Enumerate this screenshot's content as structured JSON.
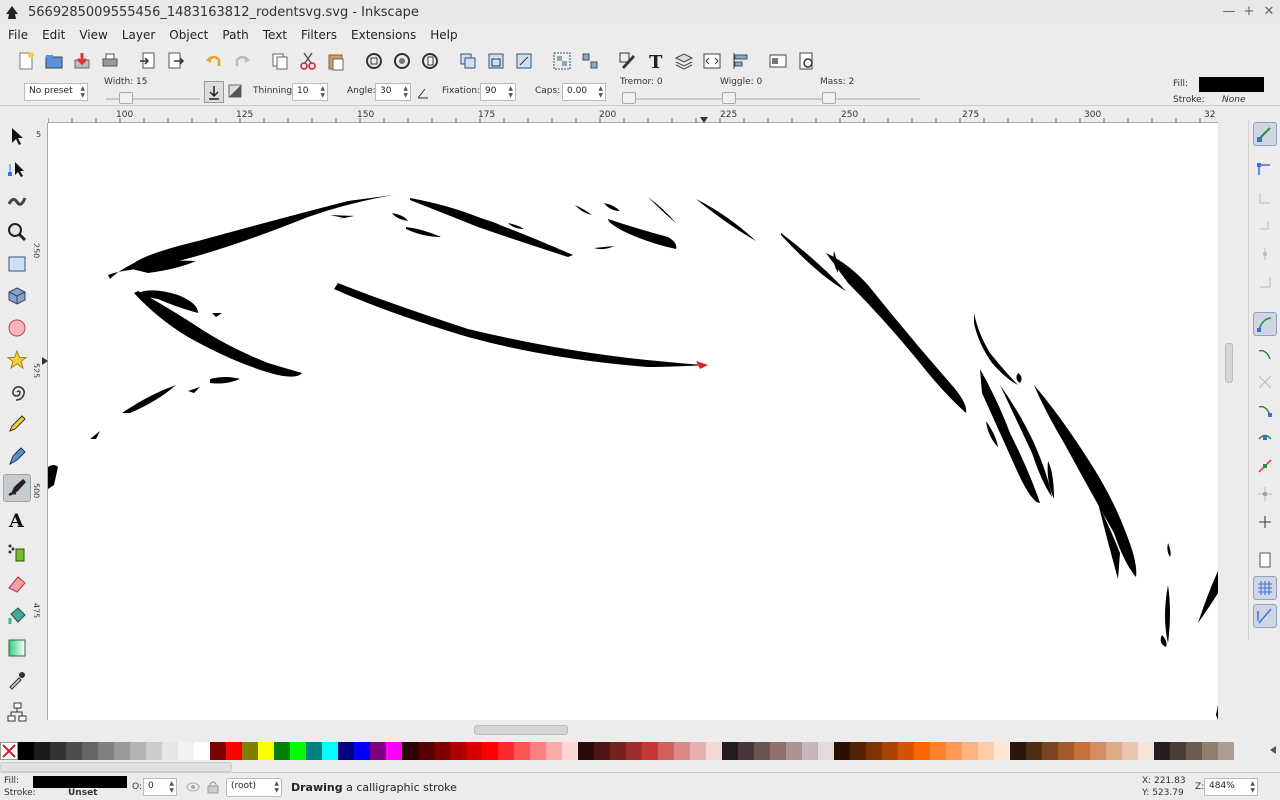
{
  "window": {
    "title": "5669285009555456_1483163812_rodentsvg.svg - Inkscape",
    "controls": [
      "—",
      "+",
      "✕"
    ]
  },
  "menu": [
    "File",
    "Edit",
    "View",
    "Layer",
    "Object",
    "Path",
    "Text",
    "Filters",
    "Extensions",
    "Help"
  ],
  "toolbar_icons": [
    "new-icon",
    "open-icon",
    "save-icon",
    "print-icon",
    "import-icon",
    "export-icon",
    "undo-icon",
    "redo-icon",
    "copy-icon",
    "cut-icon",
    "paste-icon",
    "zoom-selection-icon",
    "zoom-drawing-icon",
    "zoom-page-icon",
    "duplicate-icon",
    "clone-icon",
    "unlink-clone-icon",
    "group-icon",
    "ungroup-icon",
    "fill-stroke-icon",
    "text-font-icon",
    "layers-icon",
    "xml-editor-icon",
    "align-icon",
    "document-properties-icon",
    "preferences-icon"
  ],
  "calligraphy": {
    "preset": "No preset",
    "width_label": "Width: 15",
    "width_value": 15,
    "thinning_label": "Thinning:",
    "thinning_value": "10",
    "angle_label": "Angle:",
    "angle_value": "30",
    "fixation_label": "Fixation:",
    "fixation_value": "90",
    "caps_label": "Caps:",
    "caps_value": "0.00",
    "tremor_label": "Tremor: 0",
    "wiggle_label": "Wiggle: 0",
    "mass_label": "Mass: 2"
  },
  "style_indicator": {
    "fill_label": "Fill:",
    "stroke_label": "Stroke:",
    "stroke_value": "None",
    "fill_color": "#000000"
  },
  "ruler_h_ticks": [
    "100",
    "125",
    "150",
    "175",
    "200",
    "225",
    "250",
    "275",
    "300",
    "32"
  ],
  "ruler_v_ticks": [
    "5",
    "250",
    "525",
    "500",
    "475"
  ],
  "tools": [
    "selector-icon",
    "node-icon",
    "tweak-icon",
    "zoom-icon",
    "rectangle-icon",
    "3dbox-icon",
    "ellipse-icon",
    "star-icon",
    "spiral-icon",
    "pencil-icon",
    "pen-icon",
    "calligraphy-icon",
    "text-icon",
    "spray-icon",
    "eraser-icon",
    "paint-bucket-icon",
    "gradient-icon",
    "dropper-icon",
    "connector-icon"
  ],
  "active_tool": "calligraphy-icon",
  "palette": [
    "#000000",
    "#1a1a1a",
    "#333333",
    "#4d4d4d",
    "#666666",
    "#808080",
    "#999999",
    "#b3b3b3",
    "#cccccc",
    "#e6e6e6",
    "#f2f2f2",
    "#ffffff",
    "#800000",
    "#ff0000",
    "#808000",
    "#ffff00",
    "#008000",
    "#00ff00",
    "#008080",
    "#00ffff",
    "#000080",
    "#0000ff",
    "#800080",
    "#ff00ff",
    "#2b0000",
    "#550000",
    "#800000",
    "#aa0000",
    "#d40000",
    "#ff0000",
    "#ff2a2a",
    "#ff5555",
    "#ff8080",
    "#ffaaaa",
    "#ffd5d5",
    "#280b0b",
    "#501616",
    "#782121",
    "#a02c2c",
    "#c83737",
    "#d35f5f",
    "#de8787",
    "#e9afaf",
    "#f4d7d7",
    "#241c1c",
    "#483737",
    "#6c5353",
    "#916f6f",
    "#ac9393",
    "#c8b7b7",
    "#e3dbdb",
    "#2b1100",
    "#552200",
    "#803300",
    "#aa4400",
    "#d45500",
    "#ff6600",
    "#ff7f2a",
    "#ff9955",
    "#ffb380",
    "#ffccaa",
    "#ffe6d5",
    "#28170b",
    "#502d16",
    "#784421",
    "#a05a2c",
    "#c87137",
    "#d38d5f",
    "#deaa87",
    "#e9c6af",
    "#f4e3d7",
    "#241f1c",
    "#483e37",
    "#6c5d53",
    "#917c6f",
    "#ac9d93"
  ],
  "status": {
    "fill_label": "Fill:",
    "stroke_label": "Stroke:",
    "stroke_value": "Unset",
    "opacity_label": "O:",
    "opacity_value": "0",
    "layer": "(root)",
    "message_bold": "Drawing",
    "message_rest": " a calligraphic stroke",
    "x_coord": "X: 221.83",
    "y_coord": "Y: 523.79",
    "zoom_label": "Z:",
    "zoom_value": "484%"
  }
}
